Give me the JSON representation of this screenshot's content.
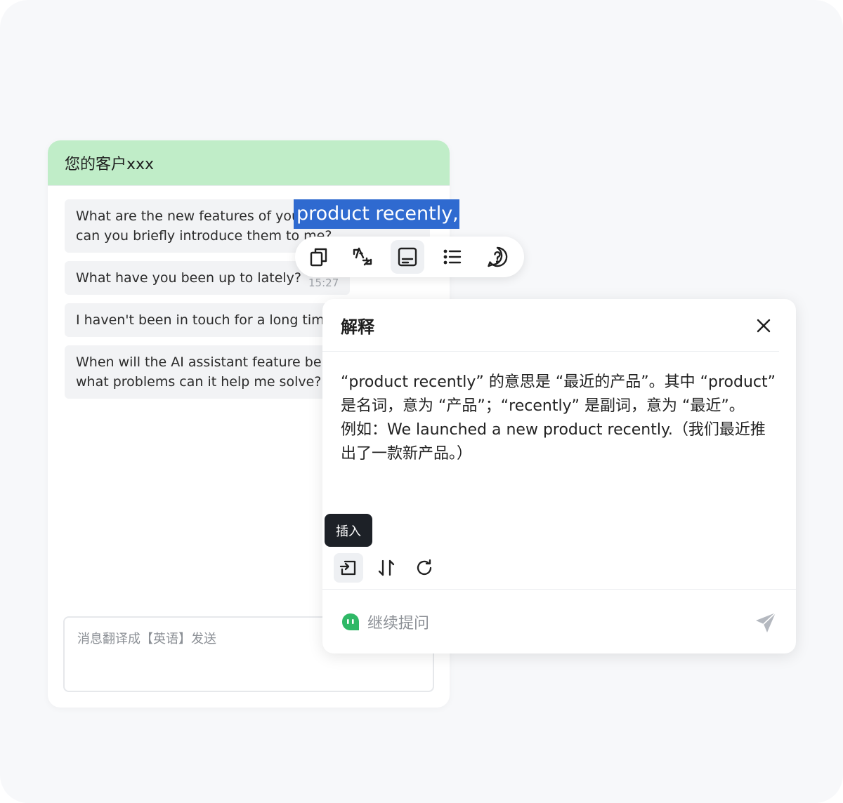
{
  "chat": {
    "contact_name": "您的客户xxx",
    "messages": [
      {
        "line1": "What are the new features of you",
        "line2": "can you briefly introduce them to me?"
      },
      {
        "text": "What have you been up to lately?",
        "time": "15:27"
      },
      {
        "text": "I haven't been in touch for a long time"
      },
      {
        "line1": "When will the AI assistant feature be l",
        "line2": "what problems can it help me solve?"
      }
    ],
    "input_placeholder": "消息翻译成【英语】发送"
  },
  "selection": {
    "text": "product recently,"
  },
  "toolbar": {
    "buttons": [
      {
        "name": "copy-icon"
      },
      {
        "name": "translate-icon"
      },
      {
        "name": "explain-icon",
        "active": true
      },
      {
        "name": "list-icon"
      },
      {
        "name": "question-icon"
      }
    ]
  },
  "explain_panel": {
    "title": "解释",
    "body": "“product recently” 的意思是 “最近的产品”。其中 “product”\n是名词，意为 “产品”；“recently” 是副词，意为 “最近”。\n例如：We launched a new product recently.（我们最近推\n出了一款新产品。）",
    "tooltip": "插入",
    "actions": [
      "insert-icon",
      "swap-icon",
      "refresh-icon"
    ],
    "followup_placeholder": "继续提问"
  },
  "colors": {
    "header_green": "#c0edc8",
    "selection_blue": "#2f6ad0",
    "ai_green": "#2fb866"
  }
}
